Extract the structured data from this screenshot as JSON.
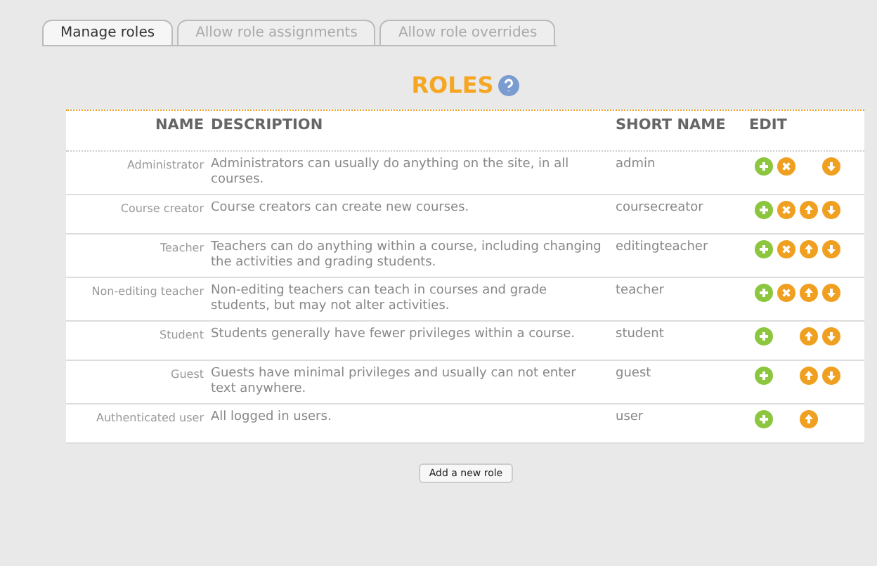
{
  "tabs": [
    {
      "label": "Manage roles",
      "selected": true
    },
    {
      "label": "Allow role assignments",
      "selected": false
    },
    {
      "label": "Allow role overrides",
      "selected": false
    }
  ],
  "heading": "ROLES",
  "table": {
    "columns": [
      "NAME",
      "DESCRIPTION",
      "SHORT NAME",
      "EDIT"
    ],
    "rows": [
      {
        "name": "Administrator",
        "description": "Administrators can usually do anything on the site, in all courses.",
        "short_name": "admin",
        "add": true,
        "delete": true,
        "up": false,
        "down": true
      },
      {
        "name": "Course creator",
        "description": "Course creators can create new courses.",
        "short_name": "coursecreator",
        "add": true,
        "delete": true,
        "up": true,
        "down": true
      },
      {
        "name": "Teacher",
        "description": "Teachers can do anything within a course, including changing the activities and grading students.",
        "short_name": "editingteacher",
        "add": true,
        "delete": true,
        "up": true,
        "down": true
      },
      {
        "name": "Non-editing teacher",
        "description": "Non-editing teachers can teach in courses and grade students, but may not alter activities.",
        "short_name": "teacher",
        "add": true,
        "delete": true,
        "up": true,
        "down": true
      },
      {
        "name": "Student",
        "description": "Students generally have fewer privileges within a course.",
        "short_name": "student",
        "add": true,
        "delete": false,
        "up": true,
        "down": true
      },
      {
        "name": "Guest",
        "description": "Guests have minimal privileges and usually can not enter text anywhere.",
        "short_name": "guest",
        "add": true,
        "delete": false,
        "up": true,
        "down": true
      },
      {
        "name": "Authenticated user",
        "description": "All logged in users.",
        "short_name": "user",
        "add": true,
        "delete": false,
        "up": true,
        "down": false
      }
    ]
  },
  "add_button": "Add a new role"
}
